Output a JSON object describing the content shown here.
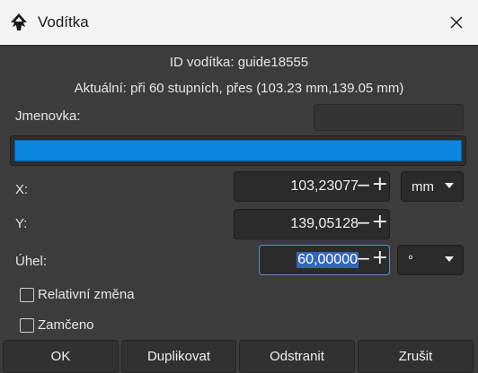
{
  "window": {
    "title": "Vodítka",
    "icon": "inkscape-icon",
    "close_icon": "close-icon"
  },
  "info": {
    "guide_id": "ID vodítka: guide18555",
    "current": "Aktuální: při 60 stupních, přes (103.23 mm,139.05 mm)"
  },
  "label_field": {
    "label": "Jmenovka:",
    "value": ""
  },
  "color": {
    "value": "#0a86e0"
  },
  "x": {
    "label": "X:",
    "value": "103,23077",
    "unit": "mm"
  },
  "y": {
    "label": "Y:",
    "value": "139,05128"
  },
  "angle": {
    "label": "Úhel:",
    "value": "60,00000",
    "unit": "°"
  },
  "checkboxes": {
    "relative": {
      "label": "Relativní změna",
      "checked": false
    },
    "locked": {
      "label": "Zamčeno",
      "checked": false
    }
  },
  "buttons": {
    "ok": "OK",
    "duplicate": "Duplikovat",
    "remove": "Odstranit",
    "cancel": "Zrušit"
  }
}
